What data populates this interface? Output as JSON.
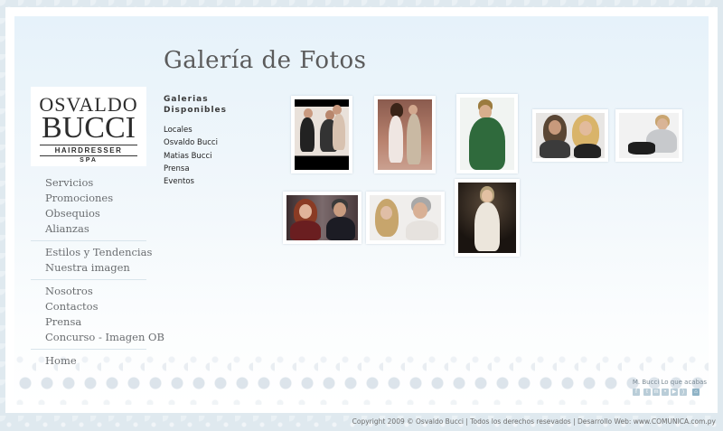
{
  "page_title": "Galería de Fotos",
  "logo": {
    "line1": "OSVALDO",
    "line2": "BUCCI",
    "line3": "HAIRDRESSER",
    "line4": "SPA"
  },
  "nav": {
    "groups": [
      [
        "Servicios",
        "Promociones",
        "Obsequios",
        "Alianzas"
      ],
      [
        "Estilos y Tendencias",
        "Nuestra imagen"
      ],
      [
        "Nosotros",
        "Contactos",
        "Prensa",
        "Concurso - Imagen OB"
      ],
      [
        "Home"
      ]
    ]
  },
  "galleries": {
    "title_line1": "Galerias",
    "title_line2": "Disponibles",
    "items": [
      "Locales",
      "Osvaldo Bucci",
      "Matias Bucci",
      "Prensa",
      "Eventos"
    ]
  },
  "thumbnails": [
    {
      "name": "photo-group-women-black-top"
    },
    {
      "name": "photo-two-people-standing"
    },
    {
      "name": "photo-man-green-suit"
    },
    {
      "name": "photo-man-and-blonde-woman"
    },
    {
      "name": "photo-man-seated-white"
    },
    {
      "name": "photo-man-and-woman-redhead"
    },
    {
      "name": "photo-stylist-with-client"
    },
    {
      "name": "photo-man-on-stage"
    }
  ],
  "social": {
    "label": "M. Bucci Lo que acabas",
    "icons": [
      "facebook-icon",
      "twitter-icon",
      "myspace-icon",
      "flickr-icon",
      "youtube-icon",
      "rss-icon",
      "home-icon"
    ]
  },
  "footer": {
    "text": "Copyright 2009 © Osvaldo Bucci | Todos los derechos resevados | Desarrollo Web: www.COMUNICA.com.py"
  },
  "colors": {
    "background": "#dfe9ef",
    "panel_top": "#e6f2fa",
    "text_gray": "#6a6d70",
    "title_gray": "#5b5b5b"
  }
}
